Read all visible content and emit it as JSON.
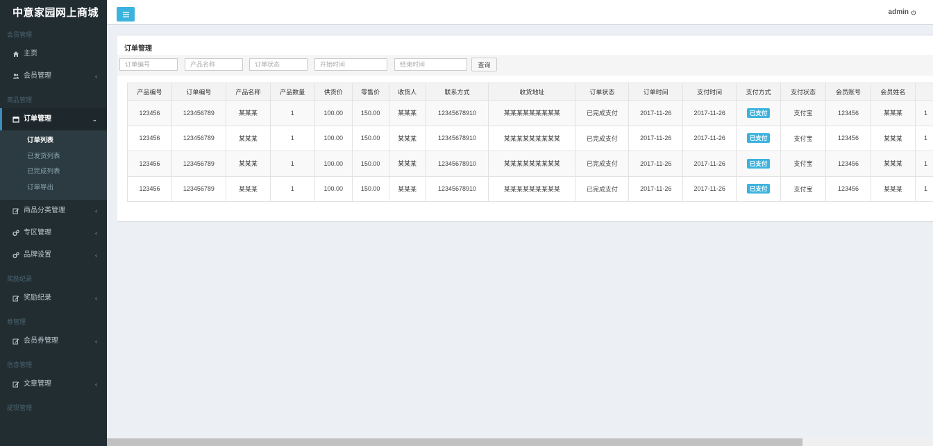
{
  "sidebar": {
    "brand": "中意家园网上商城",
    "sections": {
      "member_header": "会员管理",
      "home": "主页",
      "member_mgmt": "会员管理",
      "goods_header": "商品管理",
      "order_mgmt": "订单管理",
      "order_sub": [
        "订单列表",
        "已发货列表",
        "已完成列表",
        "订单导出"
      ],
      "category_mgmt": "商品分类管理",
      "zone_mgmt": "专区管理",
      "brand_settings": "品牌设置",
      "reward_header": "奖励纪录",
      "reward_records": "奖励纪录",
      "coupon_header": "券管理",
      "member_coupon_mgmt": "会员券管理",
      "info_header": "信息管理",
      "article_mgmt": "文章管理",
      "withdraw_header": "提现管理"
    }
  },
  "topbar": {
    "user": "admin",
    "menu_icon": "bars-icon",
    "power_icon": "power-icon"
  },
  "box": {
    "title": "订单管理",
    "filters": {
      "order_no": "订单编号",
      "product_name": "产品名称",
      "order_status": "订单状态",
      "start_time": "开始时间",
      "end_time": "结束时间"
    },
    "query_label": "查询"
  },
  "table": {
    "columns": [
      "产品编号",
      "订单编号",
      "产品名称",
      "产品数量",
      "供货价",
      "零售价",
      "收货人",
      "联系方式",
      "收货地址",
      "订单状态",
      "订单时间",
      "支付时间",
      "支付方式",
      "支付状态",
      "会员账号",
      "会员姓名",
      ""
    ],
    "rows": [
      [
        "123456",
        "123456789",
        "某某某",
        "1",
        "100.00",
        "150.00",
        "某某某",
        "12345678910",
        "某某某某某某某某某",
        "已完成支付",
        "2017-11-26",
        "2017-11-26",
        "已支付",
        "支付宝",
        "123456",
        "某某某",
        "1"
      ],
      [
        "123456",
        "123456789",
        "某某某",
        "1",
        "100.00",
        "150.00",
        "某某某",
        "12345678910",
        "某某某某某某某某某",
        "已完成支付",
        "2017-11-26",
        "2017-11-26",
        "已支付",
        "支付宝",
        "123456",
        "某某某",
        "1"
      ],
      [
        "123456",
        "123456789",
        "某某某",
        "1",
        "100.00",
        "150.00",
        "某某某",
        "12345678910",
        "某某某某某某某某某",
        "已完成支付",
        "2017-11-26",
        "2017-11-26",
        "已支付",
        "支付宝",
        "123456",
        "某某某",
        "1"
      ],
      [
        "123456",
        "123456789",
        "某某某",
        "1",
        "100.00",
        "150.00",
        "某某某",
        "12345678910",
        "某某某某某某某某某",
        "已完成支付",
        "2017-11-26",
        "2017-11-26",
        "已支付",
        "支付宝",
        "123456",
        "某某某",
        "1"
      ]
    ]
  },
  "colors": {
    "sidebar_bg": "#222d32",
    "accent": "#3cb3de",
    "active_border": "#3c8dbc"
  }
}
